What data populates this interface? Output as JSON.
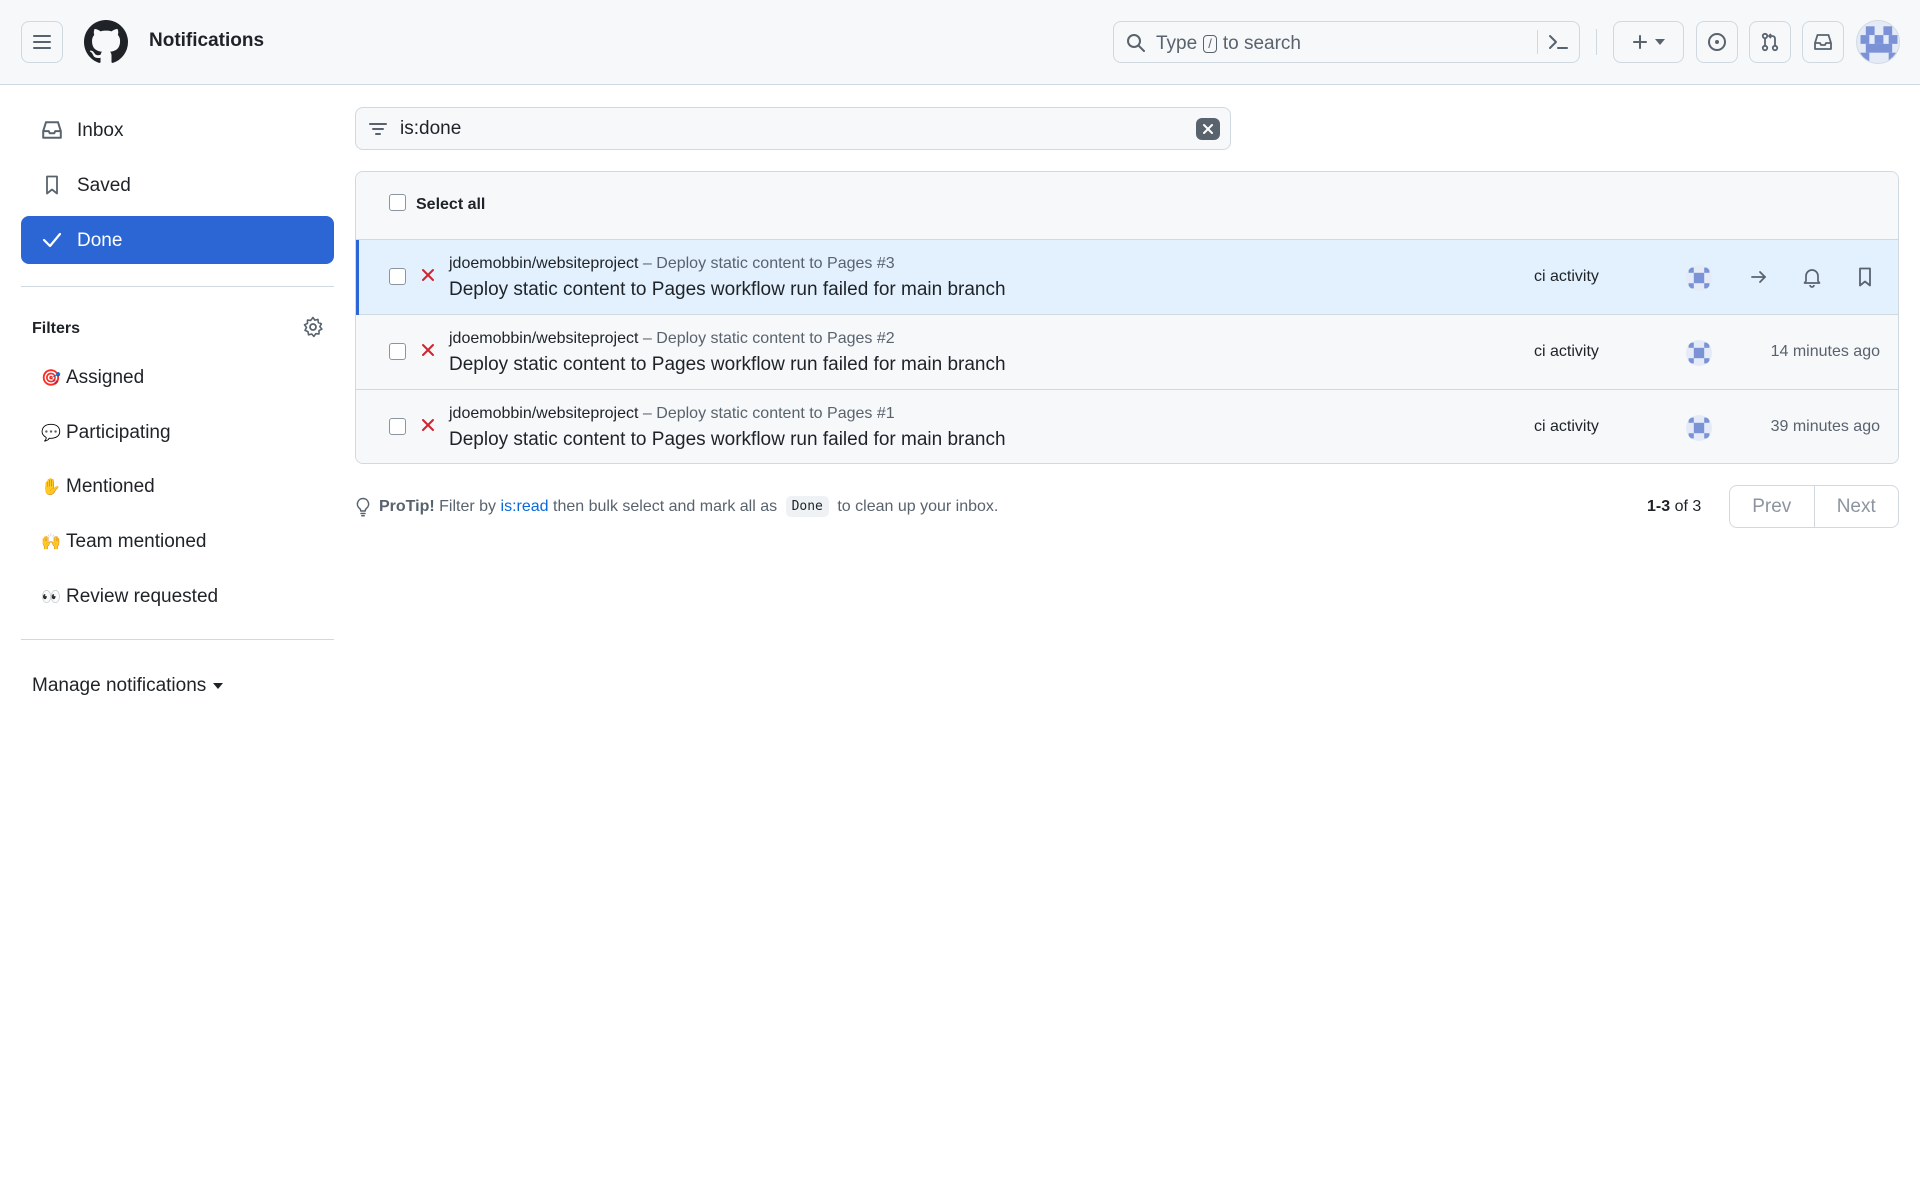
{
  "header": {
    "title": "Notifications",
    "search": {
      "prefix": "Type",
      "key": "/",
      "suffix": "to search"
    },
    "create_icon": "plus-icon",
    "icons": [
      "hamburger-icon",
      "github-logo-icon",
      "search-icon",
      "command-palette-icon",
      "issues-icon",
      "pull-request-icon",
      "inbox-icon"
    ]
  },
  "sidebar": {
    "nav": [
      {
        "label": "Inbox",
        "icon": "inbox-icon"
      },
      {
        "label": "Saved",
        "icon": "bookmark-icon"
      },
      {
        "label": "Done",
        "icon": "check-icon",
        "active": true
      }
    ],
    "filters_title": "Filters",
    "filters": [
      {
        "emoji": "🎯",
        "label": "Assigned"
      },
      {
        "emoji": "💬",
        "label": "Participating"
      },
      {
        "emoji": "✋",
        "label": "Mentioned"
      },
      {
        "emoji": "🙌",
        "label": "Team mentioned"
      },
      {
        "emoji": "👀",
        "label": "Review requested"
      }
    ],
    "manage": "Manage notifications"
  },
  "filter": {
    "value": "is:done"
  },
  "list": {
    "select_all": "Select all",
    "rows": [
      {
        "repo": "jdoemobbin/websiteproject",
        "sep": "–",
        "workflow": "Deploy static content to Pages #3",
        "title": "Deploy static content to Pages workflow run failed for main branch",
        "reason": "ci activity",
        "time": ""
      },
      {
        "repo": "jdoemobbin/websiteproject",
        "sep": "–",
        "workflow": "Deploy static content to Pages #2",
        "title": "Deploy static content to Pages workflow run failed for main branch",
        "reason": "ci activity",
        "time": "14 minutes ago"
      },
      {
        "repo": "jdoemobbin/websiteproject",
        "sep": "–",
        "workflow": "Deploy static content to Pages #1",
        "title": "Deploy static content to Pages workflow run failed for main branch",
        "reason": "ci activity",
        "time": "39 minutes ago"
      }
    ]
  },
  "protip": {
    "label": "ProTip!",
    "text1": "Filter by",
    "link": "is:read",
    "text2": "then bulk select and mark all as",
    "code": "Done",
    "text3": "to clean up your inbox."
  },
  "pagination": {
    "range": "1-3",
    "of": "of",
    "total": "3",
    "prev": "Prev",
    "next": "Next"
  },
  "colors": {
    "accent": "#2b66d4",
    "fail": "#d1242f",
    "link": "#0969da",
    "selected_row": "#e2f1fd"
  }
}
